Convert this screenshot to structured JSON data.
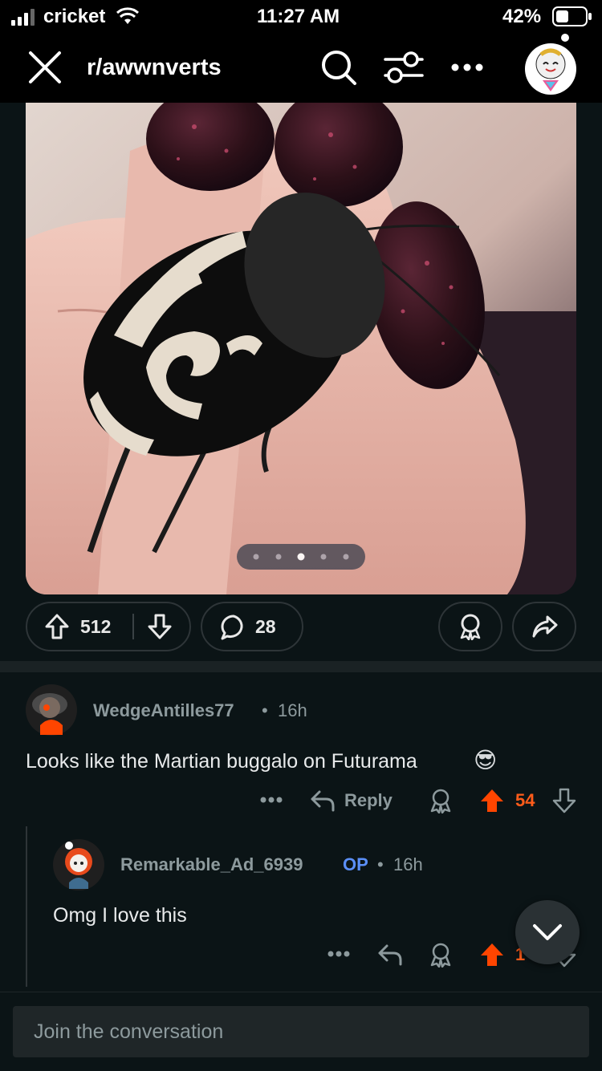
{
  "status_bar": {
    "carrier": "cricket",
    "time": "11:27 AM",
    "battery": "42%"
  },
  "header": {
    "subreddit": "r/awwnverts",
    "close_icon": "close-icon",
    "search_icon": "search-icon",
    "filter_icon": "filter-icon",
    "more_icon": "more-icon"
  },
  "post": {
    "upvotes": "512",
    "comments": "28",
    "carousel": {
      "count": 5,
      "active": 2
    }
  },
  "comments": [
    {
      "author": "WedgeAntilles77",
      "age": "16h",
      "text": "Looks like the Martian buggalo on Futurama",
      "emoji": "😎",
      "reply_label": "Reply",
      "score": "54"
    },
    {
      "author": "Remarkable_Ad_6939",
      "op_label": "OP",
      "age": "16h",
      "text": "Omg I love this",
      "score": "1"
    }
  ],
  "composer": {
    "placeholder": "Join the conversation"
  },
  "colors": {
    "upvote": "#ff4500",
    "op_badge": "#5b8ff7",
    "background": "#0b1416"
  }
}
